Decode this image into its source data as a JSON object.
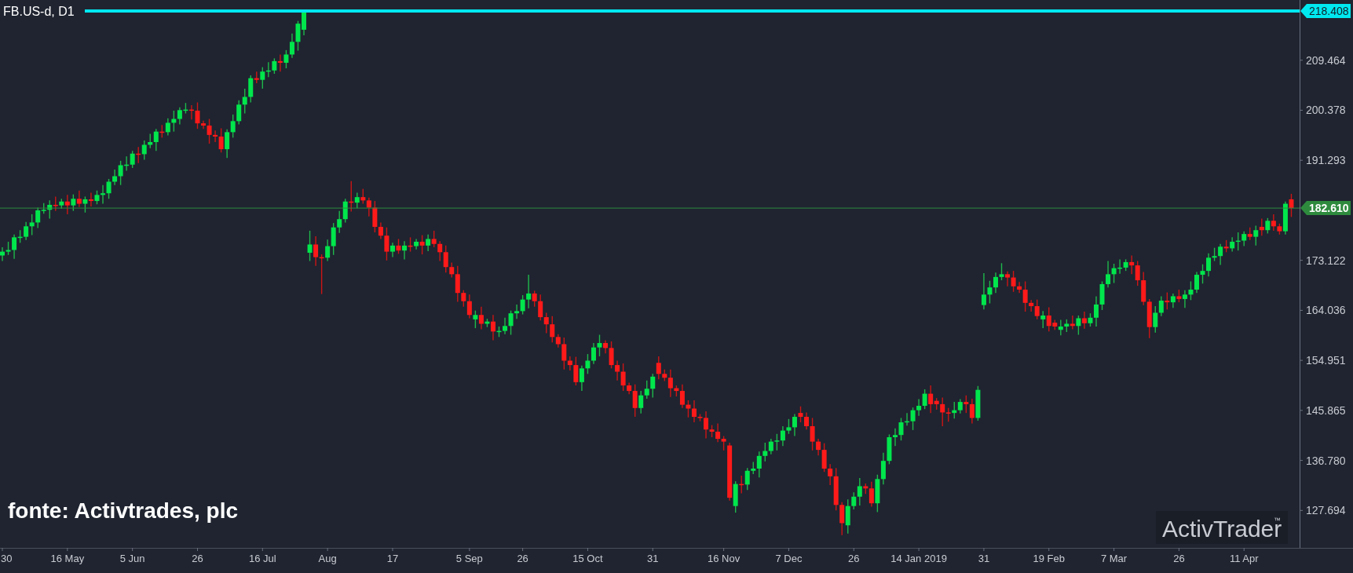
{
  "chart": {
    "symbol_title": "FB.US-d, D1",
    "chart_data": {
      "type": "candlestick",
      "categories": [
        "30",
        null,
        null,
        null,
        null,
        null,
        null,
        null,
        null,
        null,
        null,
        "16 May",
        null,
        null,
        null,
        null,
        null,
        null,
        null,
        null,
        null,
        null,
        "5 Jun",
        null,
        null,
        null,
        null,
        null,
        null,
        null,
        null,
        null,
        null,
        "26",
        null,
        null,
        null,
        null,
        null,
        null,
        null,
        null,
        null,
        null,
        "16 Jul",
        null,
        null,
        null,
        null,
        null,
        null,
        null,
        null,
        null,
        null,
        "Aug",
        null,
        null,
        null,
        null,
        null,
        null,
        null,
        null,
        null,
        null,
        "17",
        null,
        null,
        null,
        null,
        null,
        null,
        null,
        null,
        null,
        null,
        null,
        null,
        "5 Sep",
        null,
        null,
        null,
        null,
        null,
        null,
        null,
        null,
        "26",
        null,
        null,
        null,
        null,
        null,
        null,
        null,
        null,
        null,
        null,
        "15 Oct",
        null,
        null,
        null,
        null,
        null,
        null,
        null,
        null,
        null,
        null,
        "31",
        null,
        null,
        null,
        null,
        null,
        null,
        null,
        null,
        null,
        null,
        null,
        "16 Nov",
        null,
        null,
        null,
        null,
        null,
        null,
        null,
        null,
        null,
        null,
        "7 Dec",
        null,
        null,
        null,
        null,
        null,
        null,
        null,
        null,
        null,
        null,
        "26",
        null,
        null,
        null,
        null,
        null,
        null,
        null,
        null,
        null,
        null,
        "14 Jan 2019",
        null,
        null,
        null,
        null,
        null,
        null,
        null,
        null,
        null,
        null,
        "31",
        null,
        null,
        null,
        null,
        null,
        null,
        null,
        null,
        null,
        null,
        "19 Feb",
        null,
        null,
        null,
        null,
        null,
        null,
        null,
        null,
        null,
        null,
        "7 Mar",
        null,
        null,
        null,
        null,
        null,
        null,
        null,
        null,
        null,
        null,
        "26",
        null,
        null,
        null,
        null,
        null,
        null,
        null,
        null,
        null,
        null,
        "11 Apr",
        null,
        null,
        null,
        null,
        null,
        null,
        null,
        null
      ],
      "ohlc": [
        [
          174.0,
          175.5,
          173.0,
          174.7
        ],
        [
          174.7,
          176.5,
          174.1,
          175.0
        ],
        [
          175.0,
          177.8,
          173.4,
          177.3
        ],
        [
          177.3,
          178.6,
          176.3,
          177.4
        ],
        [
          177.4,
          180.1,
          176.8,
          179.3
        ],
        [
          179.3,
          181.5,
          177.7,
          180.0
        ],
        [
          180.0,
          182.7,
          179.0,
          182.2
        ],
        [
          182.2,
          183.5,
          181.6,
          182.3
        ],
        [
          182.3,
          184.0,
          180.7,
          183.2
        ],
        [
          183.2,
          184.7,
          182.1,
          183.1
        ],
        [
          183.1,
          184.3,
          182.5,
          183.8
        ],
        [
          183.8,
          185.0,
          181.5,
          183.1
        ],
        [
          183.1,
          185.1,
          182.1,
          184.3
        ],
        [
          184.3,
          185.8,
          182.8,
          183.4
        ],
        [
          183.4,
          184.7,
          181.8,
          184.2
        ],
        [
          184.2,
          185.4,
          182.9,
          183.9
        ],
        [
          183.9,
          185.8,
          183.3,
          185.0
        ],
        [
          185.0,
          186.8,
          183.4,
          185.3
        ],
        [
          185.3,
          187.9,
          184.3,
          187.4
        ],
        [
          187.4,
          189.6,
          186.8,
          188.4
        ],
        [
          188.4,
          191.2,
          186.8,
          190.4
        ],
        [
          190.4,
          192.0,
          189.4,
          190.5
        ],
        [
          190.5,
          193.0,
          189.9,
          192.5
        ],
        [
          192.5,
          193.7,
          190.8,
          192.4
        ],
        [
          192.4,
          194.9,
          191.4,
          194.1
        ],
        [
          194.1,
          196.1,
          193.5,
          194.6
        ],
        [
          194.6,
          197.0,
          193.0,
          196.5
        ],
        [
          196.5,
          197.7,
          195.4,
          196.4
        ],
        [
          196.4,
          198.9,
          195.8,
          198.1
        ],
        [
          198.1,
          200.3,
          196.5,
          198.8
        ],
        [
          198.8,
          200.9,
          197.8,
          200.4
        ],
        [
          200.4,
          201.7,
          199.8,
          200.5
        ],
        [
          200.5,
          201.3,
          198.7,
          200.3
        ],
        [
          200.3,
          201.8,
          197.0,
          198.0
        ],
        [
          198.0,
          198.5,
          197.0,
          197.6
        ],
        [
          197.6,
          198.8,
          194.3,
          195.9
        ],
        [
          195.9,
          196.7,
          194.6,
          195.6
        ],
        [
          195.6,
          197.1,
          192.7,
          193.3
        ],
        [
          193.3,
          196.9,
          191.7,
          196.4
        ],
        [
          196.4,
          199.6,
          195.4,
          198.4
        ],
        [
          198.4,
          202.2,
          197.8,
          201.4
        ],
        [
          201.4,
          204.3,
          199.8,
          202.8
        ],
        [
          202.8,
          206.7,
          201.8,
          206.2
        ],
        [
          206.2,
          207.4,
          205.3,
          205.9
        ],
        [
          205.9,
          208.2,
          204.3,
          207.4
        ],
        [
          207.4,
          209.1,
          206.4,
          207.6
        ],
        [
          207.6,
          209.8,
          207.0,
          209.3
        ],
        [
          209.3,
          210.5,
          207.4,
          209.0
        ],
        [
          209.0,
          211.3,
          208.0,
          210.5
        ],
        [
          210.5,
          214.3,
          209.9,
          212.8
        ],
        [
          212.8,
          216.6,
          211.2,
          216.1
        ],
        [
          215.0,
          218.4,
          214.0,
          218.2
        ],
        [
          174.5,
          178.5,
          173.0,
          176.0
        ],
        [
          176.0,
          177.5,
          172.1,
          173.7
        ],
        [
          173.7,
          174.2,
          167.0,
          173.6
        ],
        [
          173.6,
          176.9,
          173.0,
          175.7
        ],
        [
          175.7,
          179.9,
          174.1,
          179.1
        ],
        [
          179.1,
          182.1,
          178.1,
          180.6
        ],
        [
          180.6,
          184.3,
          180.0,
          183.8
        ],
        [
          183.8,
          187.5,
          182.0,
          183.6
        ],
        [
          183.6,
          185.4,
          182.6,
          184.6
        ],
        [
          184.6,
          186.1,
          183.4,
          184.0
        ],
        [
          184.0,
          184.5,
          181.1,
          182.7
        ],
        [
          182.7,
          183.9,
          178.2,
          179.2
        ],
        [
          179.2,
          180.0,
          177.0,
          177.6
        ],
        [
          177.6,
          179.1,
          173.1,
          174.7
        ],
        [
          174.7,
          176.3,
          173.7,
          175.8
        ],
        [
          175.8,
          177.0,
          174.3,
          174.9
        ],
        [
          174.9,
          176.6,
          173.3,
          175.8
        ],
        [
          175.8,
          177.3,
          174.7,
          175.7
        ],
        [
          175.7,
          177.0,
          175.1,
          176.5
        ],
        [
          176.5,
          177.7,
          174.2,
          175.8
        ],
        [
          175.8,
          177.8,
          174.8,
          177.0
        ],
        [
          177.0,
          178.5,
          175.5,
          176.1
        ],
        [
          176.1,
          176.6,
          173.0,
          174.6
        ],
        [
          174.6,
          175.8,
          170.9,
          171.9
        ],
        [
          171.9,
          172.7,
          170.0,
          170.6
        ],
        [
          170.6,
          172.1,
          165.6,
          167.2
        ],
        [
          167.2,
          167.7,
          164.7,
          165.7
        ],
        [
          165.7,
          166.9,
          162.6,
          163.2
        ],
        [
          162.4,
          164.0,
          160.8,
          163.2
        ],
        [
          163.2,
          164.7,
          160.6,
          161.6
        ],
        [
          161.6,
          162.5,
          161.0,
          162.0
        ],
        [
          162.0,
          163.2,
          158.6,
          160.2
        ],
        [
          160.2,
          161.1,
          159.2,
          160.3
        ],
        [
          160.3,
          162.7,
          159.7,
          161.2
        ],
        [
          161.2,
          164.0,
          159.6,
          163.5
        ],
        [
          163.5,
          165.1,
          162.5,
          163.9
        ],
        [
          163.9,
          166.8,
          163.3,
          166.0
        ],
        [
          166.0,
          170.5,
          164.4,
          167.1
        ],
        [
          167.1,
          167.6,
          164.7,
          165.7
        ],
        [
          165.7,
          166.9,
          162.2,
          162.8
        ],
        [
          162.8,
          163.6,
          159.9,
          161.5
        ],
        [
          161.5,
          163.0,
          158.2,
          159.2
        ],
        [
          159.2,
          159.7,
          157.3,
          157.9
        ],
        [
          157.9,
          159.1,
          153.3,
          154.9
        ],
        [
          154.9,
          155.7,
          153.1,
          154.1
        ],
        [
          154.1,
          155.6,
          150.4,
          151.0
        ],
        [
          151.0,
          154.0,
          149.4,
          153.5
        ],
        [
          153.5,
          156.1,
          152.5,
          154.9
        ],
        [
          154.9,
          158.1,
          154.3,
          157.3
        ],
        [
          157.3,
          159.6,
          155.7,
          158.1
        ],
        [
          158.1,
          158.6,
          156.2,
          157.2
        ],
        [
          157.2,
          158.4,
          153.5,
          154.1
        ],
        [
          154.1,
          154.9,
          151.3,
          152.9
        ],
        [
          152.9,
          154.4,
          149.4,
          150.4
        ],
        [
          150.4,
          150.9,
          148.8,
          149.4
        ],
        [
          149.4,
          150.6,
          144.7,
          146.3
        ],
        [
          146.3,
          149.4,
          145.3,
          148.6
        ],
        [
          148.6,
          151.3,
          148.0,
          149.8
        ],
        [
          149.8,
          152.5,
          148.2,
          152.0
        ],
        [
          154.5,
          155.7,
          151.5,
          152.5
        ],
        [
          152.5,
          153.3,
          151.2,
          151.8
        ],
        [
          151.8,
          153.3,
          148.3,
          149.9
        ],
        [
          149.9,
          150.4,
          148.4,
          149.4
        ],
        [
          149.4,
          150.6,
          146.3,
          146.9
        ],
        [
          146.9,
          147.7,
          144.6,
          146.2
        ],
        [
          146.2,
          147.7,
          143.7,
          144.7
        ],
        [
          144.7,
          145.2,
          143.9,
          144.5
        ],
        [
          144.5,
          145.7,
          140.8,
          142.4
        ],
        [
          142.4,
          143.2,
          141.0,
          142.0
        ],
        [
          142.0,
          143.5,
          140.1,
          140.7
        ],
        [
          140.7,
          141.2,
          138.6,
          140.2
        ],
        [
          139.5,
          140.0,
          129.5,
          130.0
        ],
        [
          128.5,
          133.0,
          127.3,
          132.5
        ],
        [
          132.5,
          134.0,
          130.8,
          132.4
        ],
        [
          132.4,
          135.4,
          131.4,
          134.9
        ],
        [
          134.9,
          136.5,
          134.3,
          135.3
        ],
        [
          135.3,
          138.4,
          133.7,
          137.6
        ],
        [
          137.6,
          140.0,
          136.6,
          138.5
        ],
        [
          138.5,
          140.7,
          137.9,
          140.2
        ],
        [
          140.2,
          141.6,
          138.6,
          140.4
        ],
        [
          140.4,
          143.0,
          139.4,
          142.2
        ],
        [
          142.2,
          144.3,
          141.6,
          142.8
        ],
        [
          142.8,
          145.2,
          141.2,
          144.7
        ],
        [
          145.4,
          146.6,
          143.7,
          144.7
        ],
        [
          144.7,
          145.5,
          142.4,
          143.0
        ],
        [
          143.0,
          144.5,
          138.6,
          140.2
        ],
        [
          140.2,
          140.7,
          137.7,
          138.7
        ],
        [
          138.7,
          139.9,
          134.7,
          135.3
        ],
        [
          135.3,
          136.1,
          132.3,
          133.9
        ],
        [
          133.9,
          135.4,
          127.7,
          128.7
        ],
        [
          128.7,
          129.2,
          123.2,
          125.4
        ],
        [
          125.0,
          129.7,
          123.5,
          128.5
        ],
        [
          128.5,
          131.0,
          127.9,
          130.2
        ],
        [
          130.2,
          133.6,
          128.6,
          132.1
        ],
        [
          132.1,
          132.6,
          130.7,
          131.7
        ],
        [
          131.7,
          132.9,
          128.4,
          129.0
        ],
        [
          129.0,
          134.2,
          127.4,
          133.4
        ],
        [
          133.4,
          138.2,
          132.4,
          136.7
        ],
        [
          136.7,
          141.5,
          136.1,
          141.0
        ],
        [
          141.0,
          142.6,
          139.4,
          141.4
        ],
        [
          141.4,
          144.5,
          140.4,
          143.7
        ],
        [
          143.7,
          145.4,
          143.1,
          143.9
        ],
        [
          143.9,
          146.4,
          142.3,
          145.9
        ],
        [
          145.9,
          147.9,
          144.9,
          146.7
        ],
        [
          146.7,
          149.7,
          146.1,
          148.9
        ],
        [
          148.9,
          150.4,
          145.4,
          147.0
        ],
        [
          147.6,
          148.1,
          146.0,
          147.0
        ],
        [
          147.0,
          148.2,
          143.0,
          145.5
        ],
        [
          145.5,
          146.3,
          143.8,
          145.4
        ],
        [
          145.4,
          147.4,
          144.4,
          145.9
        ],
        [
          145.9,
          147.9,
          145.3,
          147.4
        ],
        [
          147.4,
          148.6,
          145.4,
          147.0
        ],
        [
          147.0,
          148.0,
          143.5,
          144.5
        ],
        [
          144.5,
          150.3,
          144.0,
          149.6
        ],
        [
          165.0,
          170.8,
          164.2,
          166.9
        ],
        [
          166.9,
          169.4,
          165.3,
          168.2
        ],
        [
          168.2,
          170.9,
          167.2,
          170.1
        ],
        [
          170.1,
          172.6,
          169.5,
          170.6
        ],
        [
          170.6,
          171.1,
          168.4,
          170.0
        ],
        [
          170.0,
          171.2,
          167.4,
          168.4
        ],
        [
          168.4,
          169.2,
          167.2,
          167.8
        ],
        [
          167.8,
          169.3,
          163.8,
          165.4
        ],
        [
          165.4,
          165.9,
          163.8,
          164.8
        ],
        [
          164.8,
          166.0,
          162.4,
          163.0
        ],
        [
          162.4,
          163.9,
          160.8,
          163.1
        ],
        [
          163.1,
          164.6,
          160.2,
          161.2
        ],
        [
          161.8,
          162.3,
          160.5,
          161.1
        ],
        [
          160.5,
          162.3,
          159.5,
          161.1
        ],
        [
          161.1,
          162.4,
          160.1,
          161.6
        ],
        [
          161.6,
          163.1,
          160.6,
          161.2
        ],
        [
          161.2,
          163.1,
          159.6,
          162.6
        ],
        [
          162.6,
          163.8,
          160.7,
          161.7
        ],
        [
          161.7,
          163.5,
          161.1,
          162.7
        ],
        [
          162.7,
          166.6,
          161.1,
          165.1
        ],
        [
          165.1,
          169.3,
          164.1,
          168.8
        ],
        [
          168.8,
          173.0,
          168.2,
          170.6
        ],
        [
          170.6,
          172.5,
          169.0,
          171.7
        ],
        [
          171.7,
          173.3,
          170.7,
          171.8
        ],
        [
          171.8,
          173.3,
          171.2,
          172.8
        ],
        [
          172.8,
          174.0,
          170.6,
          172.2
        ],
        [
          172.2,
          173.0,
          168.5,
          169.5
        ],
        [
          169.5,
          171.0,
          165.0,
          165.6
        ],
        [
          165.6,
          166.1,
          159.0,
          161.0
        ],
        [
          161.0,
          164.8,
          160.0,
          163.6
        ],
        [
          163.6,
          166.6,
          163.0,
          165.8
        ],
        [
          165.8,
          167.3,
          164.2,
          165.5
        ],
        [
          165.5,
          167.1,
          164.5,
          166.6
        ],
        [
          166.6,
          167.8,
          165.5,
          166.1
        ],
        [
          166.1,
          167.7,
          164.5,
          166.9
        ],
        [
          166.9,
          169.3,
          165.9,
          167.8
        ],
        [
          167.8,
          171.0,
          167.2,
          170.5
        ],
        [
          170.5,
          172.4,
          168.9,
          171.2
        ],
        [
          171.2,
          174.4,
          170.2,
          173.6
        ],
        [
          173.6,
          175.4,
          173.0,
          173.9
        ],
        [
          173.9,
          176.1,
          172.3,
          175.6
        ],
        [
          175.6,
          176.8,
          174.6,
          175.3
        ],
        [
          175.3,
          177.3,
          174.7,
          176.5
        ],
        [
          176.5,
          178.2,
          174.9,
          176.7
        ],
        [
          176.7,
          178.4,
          175.7,
          177.9
        ],
        [
          177.9,
          179.1,
          176.8,
          177.4
        ],
        [
          177.4,
          179.4,
          175.8,
          178.6
        ],
        [
          179.2,
          180.7,
          177.6,
          178.6
        ],
        [
          178.6,
          180.8,
          178.0,
          180.3
        ],
        [
          180.3,
          181.5,
          178.5,
          179.3
        ],
        [
          179.3,
          179.8,
          177.8,
          178.4
        ],
        [
          178.4,
          183.8,
          177.8,
          183.4
        ],
        [
          184.2,
          185.2,
          181.0,
          182.6
        ]
      ],
      "ylim": [
        120.9,
        220.4
      ],
      "ref_lines": [
        {
          "axis": "y",
          "value": 218.408,
          "label": "218.408",
          "color": "#00e8f0"
        },
        {
          "axis": "y",
          "value": 182.61,
          "label": "182.610",
          "color": "#2e8b3e"
        }
      ],
      "yticks": [
        {
          "value": 209.464,
          "label": "209.464"
        },
        {
          "value": 200.378,
          "label": "200.378"
        },
        {
          "value": 191.293,
          "label": "191.293"
        },
        {
          "value": 173.122,
          "label": "173.122"
        },
        {
          "value": 164.036,
          "label": "164.036"
        },
        {
          "value": 154.951,
          "label": "154.951"
        },
        {
          "value": 145.865,
          "label": "145.865"
        },
        {
          "value": 136.78,
          "label": "136.780"
        },
        {
          "value": 127.694,
          "label": "127.694"
        }
      ]
    },
    "price_lines": [
      {
        "kind": "level"
      },
      {
        "kind": "current"
      }
    ],
    "source_caption": "fonte: Activtrades, plc",
    "logo": {
      "name": "ActivTrader",
      "trademark": "™"
    }
  }
}
